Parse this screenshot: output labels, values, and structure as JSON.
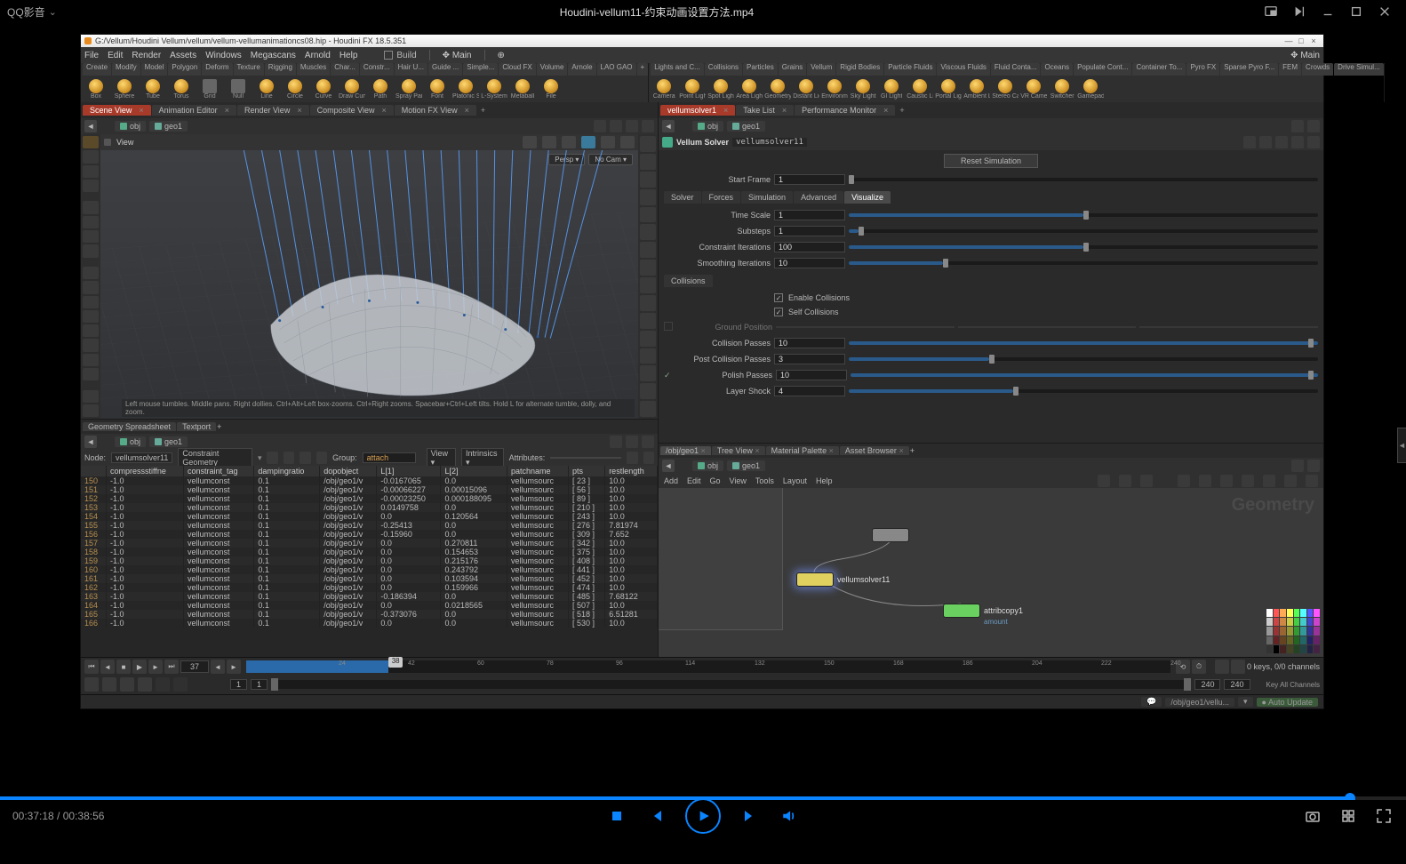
{
  "player": {
    "app_name": "QQ影音",
    "video_title": "Houdini-vellum11-约束动画设置方法.mp4",
    "cur_time": "00:37:18",
    "total_time": "00:38:56",
    "progress_pct": 96
  },
  "houdini": {
    "titlebar": "G:/Vellum/Houdini Vellum/vellum/vellum-vellumanimationcs08.hip - Houdini FX 18.5.351",
    "menu": [
      "File",
      "Edit",
      "Render",
      "Assets",
      "Windows",
      "Megascans",
      "Arnold",
      "Help"
    ],
    "build_label": "Build",
    "main_label": "Main",
    "shelf_left_tabs": [
      "Create",
      "Modify",
      "Model",
      "Polygon",
      "Deform",
      "Texture",
      "Rigging",
      "Muscles",
      "Char...",
      "Constr...",
      "Hair U...",
      "Guide ...",
      "Simple...",
      "Cloud FX",
      "Volume",
      "Arnole",
      "LAO GAO",
      "+"
    ],
    "shelf_left_tools": [
      "Box",
      "Sphere",
      "Tube",
      "Torus",
      "Grid",
      "Null",
      "Line",
      "Circle",
      "Curve",
      "Draw Curve",
      "Path",
      "Spray Paint",
      "Font",
      "Platonic Solids",
      "L-System",
      "Metaball",
      "File"
    ],
    "shelf_right_tabs": [
      "Lights and C...",
      "Collisions",
      "Particles",
      "Grains",
      "Vellum",
      "Rigid Bodies",
      "Particle Fluids",
      "Viscous Fluids",
      "Fluid Conta...",
      "Oceans",
      "Populate Cont...",
      "Container To...",
      "Pyro FX",
      "Sparse Pyro F...",
      "FEM",
      "Crowds",
      "Drive Simul..."
    ],
    "shelf_right_tools": [
      "Camera",
      "Point Light",
      "Spot Light",
      "Area Light",
      "Geometry Light",
      "Distant Light",
      "Environment Light",
      "Sky Light",
      "GI Light",
      "Caustic Light",
      "Portal Light",
      "Ambient Light",
      "Stereo Camera",
      "VR Camera",
      "Switcher",
      "Gamepad Camera"
    ],
    "scene_tabs": [
      {
        "label": "Scene View",
        "active": true
      },
      {
        "label": "Animation Editor",
        "active": false
      },
      {
        "label": "Render View",
        "active": false
      },
      {
        "label": "Composite View",
        "active": false
      },
      {
        "label": "Motion FX View",
        "active": false
      }
    ],
    "path_obj": "obj",
    "path_geo": "geo1",
    "view_label": "View",
    "persp_label": "Persp",
    "nocam_label": "No Cam",
    "viewport_status": "Left mouse tumbles. Middle pans. Right dollies. Ctrl+Alt+Left box-zooms. Ctrl+Right zooms. Spacebar+Ctrl+Left tilts. Hold L for alternate tumble, dolly, and zoom.",
    "geo_tabs": [
      "Geometry Spreadsheet",
      "Textport"
    ],
    "geo_node_label": "Node:",
    "geo_node": "vellumsolver11",
    "geo_constraint_label": "Constraint Geometry",
    "geo_group_label": "Group:",
    "geo_group": "attach",
    "geo_view_label": "View",
    "geo_intrinsics_label": "Intrinsics",
    "geo_attrs_label": "Attributes:",
    "geo_cols": [
      "",
      "compressstiffne",
      "constraint_tag",
      "dampingratio",
      "dopobject",
      "L[1]",
      "L[2]",
      "patchname",
      "pts",
      "restlength"
    ],
    "geo_rows": [
      [
        "150",
        "-1.0",
        "vellumconst",
        "0.1",
        "/obj/geo1/v",
        "-0.0167065",
        "0.0",
        "vellumsourc",
        "[ 23 ]",
        "10.0"
      ],
      [
        "151",
        "-1.0",
        "vellumconst",
        "0.1",
        "/obj/geo1/v",
        "-0.00066227",
        "0.00015096",
        "vellumsourc",
        "[ 56 ]",
        "10.0"
      ],
      [
        "152",
        "-1.0",
        "vellumconst",
        "0.1",
        "/obj/geo1/v",
        "-0.00023250",
        "0.000188095",
        "vellumsourc",
        "[ 89 ]",
        "10.0"
      ],
      [
        "153",
        "-1.0",
        "vellumconst",
        "0.1",
        "/obj/geo1/v",
        "0.0149758",
        "0.0",
        "vellumsourc",
        "[ 210 ]",
        "10.0"
      ],
      [
        "154",
        "-1.0",
        "vellumconst",
        "0.1",
        "/obj/geo1/v",
        "0.0",
        "0.120564",
        "vellumsourc",
        "[ 243 ]",
        "10.0"
      ],
      [
        "155",
        "-1.0",
        "vellumconst",
        "0.1",
        "/obj/geo1/v",
        "-0.25413",
        "0.0",
        "vellumsourc",
        "[ 276 ]",
        "7.81974"
      ],
      [
        "156",
        "-1.0",
        "vellumconst",
        "0.1",
        "/obj/geo1/v",
        "-0.15960",
        "0.0",
        "vellumsourc",
        "[ 309 ]",
        "7.652"
      ],
      [
        "157",
        "-1.0",
        "vellumconst",
        "0.1",
        "/obj/geo1/v",
        "0.0",
        "0.270811",
        "vellumsourc",
        "[ 342 ]",
        "10.0"
      ],
      [
        "158",
        "-1.0",
        "vellumconst",
        "0.1",
        "/obj/geo1/v",
        "0.0",
        "0.154653",
        "vellumsourc",
        "[ 375 ]",
        "10.0"
      ],
      [
        "159",
        "-1.0",
        "vellumconst",
        "0.1",
        "/obj/geo1/v",
        "0.0",
        "0.215176",
        "vellumsourc",
        "[ 408 ]",
        "10.0"
      ],
      [
        "160",
        "-1.0",
        "vellumconst",
        "0.1",
        "/obj/geo1/v",
        "0.0",
        "0.243792",
        "vellumsourc",
        "[ 441 ]",
        "10.0"
      ],
      [
        "161",
        "-1.0",
        "vellumconst",
        "0.1",
        "/obj/geo1/v",
        "0.0",
        "0.103594",
        "vellumsourc",
        "[ 452 ]",
        "10.0"
      ],
      [
        "162",
        "-1.0",
        "vellumconst",
        "0.1",
        "/obj/geo1/v",
        "0.0",
        "0.159966",
        "vellumsourc",
        "[ 474 ]",
        "10.0"
      ],
      [
        "163",
        "-1.0",
        "vellumconst",
        "0.1",
        "/obj/geo1/v",
        "-0.186394",
        "0.0",
        "vellumsourc",
        "[ 485 ]",
        "7.68122"
      ],
      [
        "164",
        "-1.0",
        "vellumconst",
        "0.1",
        "/obj/geo1/v",
        "0.0",
        "0.0218565",
        "vellumsourc",
        "[ 507 ]",
        "10.0"
      ],
      [
        "165",
        "-1.0",
        "vellumconst",
        "0.1",
        "/obj/geo1/v",
        "-0.373076",
        "0.0",
        "vellumsourc",
        "[ 518 ]",
        "6.51281"
      ],
      [
        "166",
        "-1.0",
        "vellumconst",
        "0.1",
        "/obj/geo1/v",
        "0.0",
        "0.0",
        "vellumsourc",
        "[ 530 ]",
        "10.0"
      ]
    ],
    "parm": {
      "tabs_outer": [
        {
          "label": "vellumsolver1",
          "active": true
        },
        {
          "label": "Take List",
          "active": false
        },
        {
          "label": "Performance Monitor",
          "active": false
        }
      ],
      "node_type": "Vellum Solver",
      "node_name": "vellumsolver11",
      "reset_btn": "Reset Simulation",
      "start_frame_lbl": "Start Frame",
      "start_frame": "1",
      "tabs": [
        "Solver",
        "Forces",
        "Simulation",
        "Advanced",
        "Visualize"
      ],
      "active_tab": "Visualize",
      "time_scale_lbl": "Time Scale",
      "time_scale": "1",
      "substeps_lbl": "Substeps",
      "substeps": "1",
      "citer_lbl": "Constraint Iterations",
      "citer": "100",
      "siter_lbl": "Smoothing Iterations",
      "siter": "10",
      "coll_tab": "Collisions",
      "enable_coll": "Enable Collisions",
      "self_coll": "Self Collisions",
      "ground_lbl": "Ground Position",
      "cpass_lbl": "Collision Passes",
      "cpass": "10",
      "pcpass_lbl": "Post Collision Passes",
      "pcpass": "3",
      "ppass_lbl": "Polish Passes",
      "ppass": "10",
      "lshock_lbl": "Layer Shock",
      "lshock": "4"
    },
    "net": {
      "tabs": [
        {
          "label": "/obj/geo1",
          "active": true
        },
        {
          "label": "Tree View",
          "active": false
        },
        {
          "label": "Material Palette",
          "active": false
        },
        {
          "label": "Asset Browser",
          "active": false
        }
      ],
      "menu": [
        "Add",
        "Edit",
        "Go",
        "View",
        "Tools",
        "Layout",
        "Help"
      ],
      "watermark": "Geometry",
      "node1": "vellumsolver11",
      "node2": "attribcopy1",
      "node2_sub": "amount"
    },
    "timeline": {
      "cur_frame": "37",
      "head": "38",
      "ticks": [
        "24",
        "42",
        "60",
        "78",
        "96",
        "114",
        "132",
        "150",
        "168",
        "186",
        "204",
        "222",
        "240"
      ],
      "range_start": "1",
      "range_end": "240",
      "range_end2": "240",
      "keys_info": "0 keys, 0/0 channels",
      "key_all": "Key All Channels"
    },
    "status": {
      "path": "/obj/geo1/vellu...",
      "update": "Auto Update"
    }
  }
}
